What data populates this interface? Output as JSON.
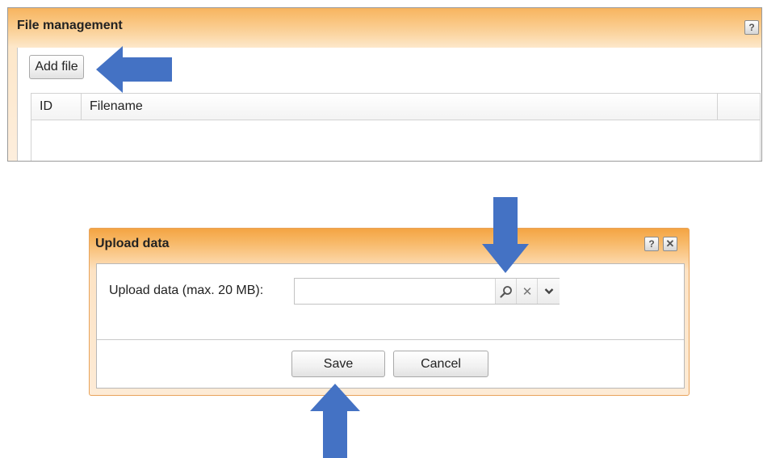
{
  "file_management": {
    "title": "File management",
    "help_label": "?",
    "add_file_label": "Add file",
    "columns": [
      "ID",
      "Filename",
      ""
    ]
  },
  "upload_dialog": {
    "title": "Upload data",
    "help_label": "?",
    "close_label": "✕",
    "field_label": "Upload data (max. 20 MB):",
    "field_value": "",
    "clear_label": "✕",
    "save_label": "Save",
    "cancel_label": "Cancel"
  },
  "colors": {
    "header_orange": "#f7b45f",
    "arrow_blue": "#4472c4"
  },
  "icons": [
    "search-icon",
    "clear-icon",
    "chevron-down-icon",
    "help-icon",
    "close-icon"
  ]
}
